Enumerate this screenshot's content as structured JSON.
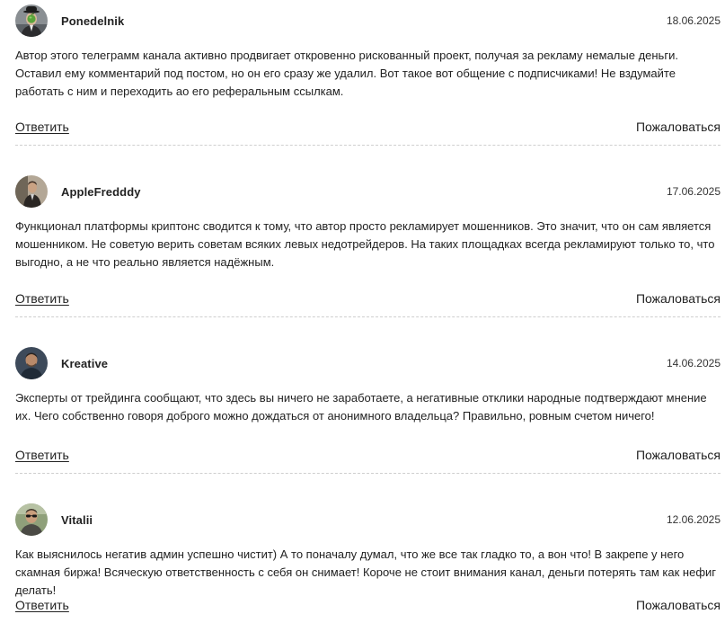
{
  "comments": [
    {
      "author": "Ponedelnik",
      "date": "18.06.2025",
      "text": "Автор этого телеграмм канала активно продвигает откровенно рискованный проект, получая за рекламу немалые деньги. Оставил ему комментарий под постом, но он его сразу же удалил. Вот такое вот общение с подписчиками! Не вздумайте работать с ним и переходить ао его реферальным ссылкам.",
      "reply_label": "Ответить",
      "report_label": "Пожаловаться",
      "avatar_icon": "bowler-hat-apple-portrait-icon"
    },
    {
      "author": "AppleFredddy",
      "date": "17.06.2025",
      "text": "Функционал платформы криптонс сводится к тому, что автор просто рекламирует мошенников. Это значит, что он сам является мошенником. Не советую верить советам всяких левых недотрейдеров. На таких площадках всегда рекламируют только то, что выгодно, а не что реально является надёжным.",
      "reply_label": "Ответить",
      "report_label": "Пожаловаться",
      "avatar_icon": "man-in-suit-photo-icon"
    },
    {
      "author": "Kreative",
      "date": "14.06.2025",
      "text": "Эксперты от трейдинга сообщают, что здесь вы ничего не заработаете, а негативные отклики народные подтверждают мнение их. Чего собственно говоря доброго можно дождаться от анонимного владельца? Правильно, ровным счетом ничего!",
      "reply_label": "Ответить",
      "report_label": "Пожаловаться",
      "avatar_icon": "man-portrait-photo-icon"
    },
    {
      "author": "Vitalii",
      "date": "12.06.2025",
      "text": "Как выяснилось негатив админ успешно чистит) А то поначалу думал, что же все так гладко то, а вон что! В закрепе у него скамная биржа! Всяческую ответственность с себя он снимает! Короче не стоит внимания канал, деньги потерять там как нефиг делать!",
      "reply_label": "Ответить",
      "report_label": "Пожаловаться",
      "avatar_icon": "man-with-sunglasses-photo-icon"
    }
  ]
}
